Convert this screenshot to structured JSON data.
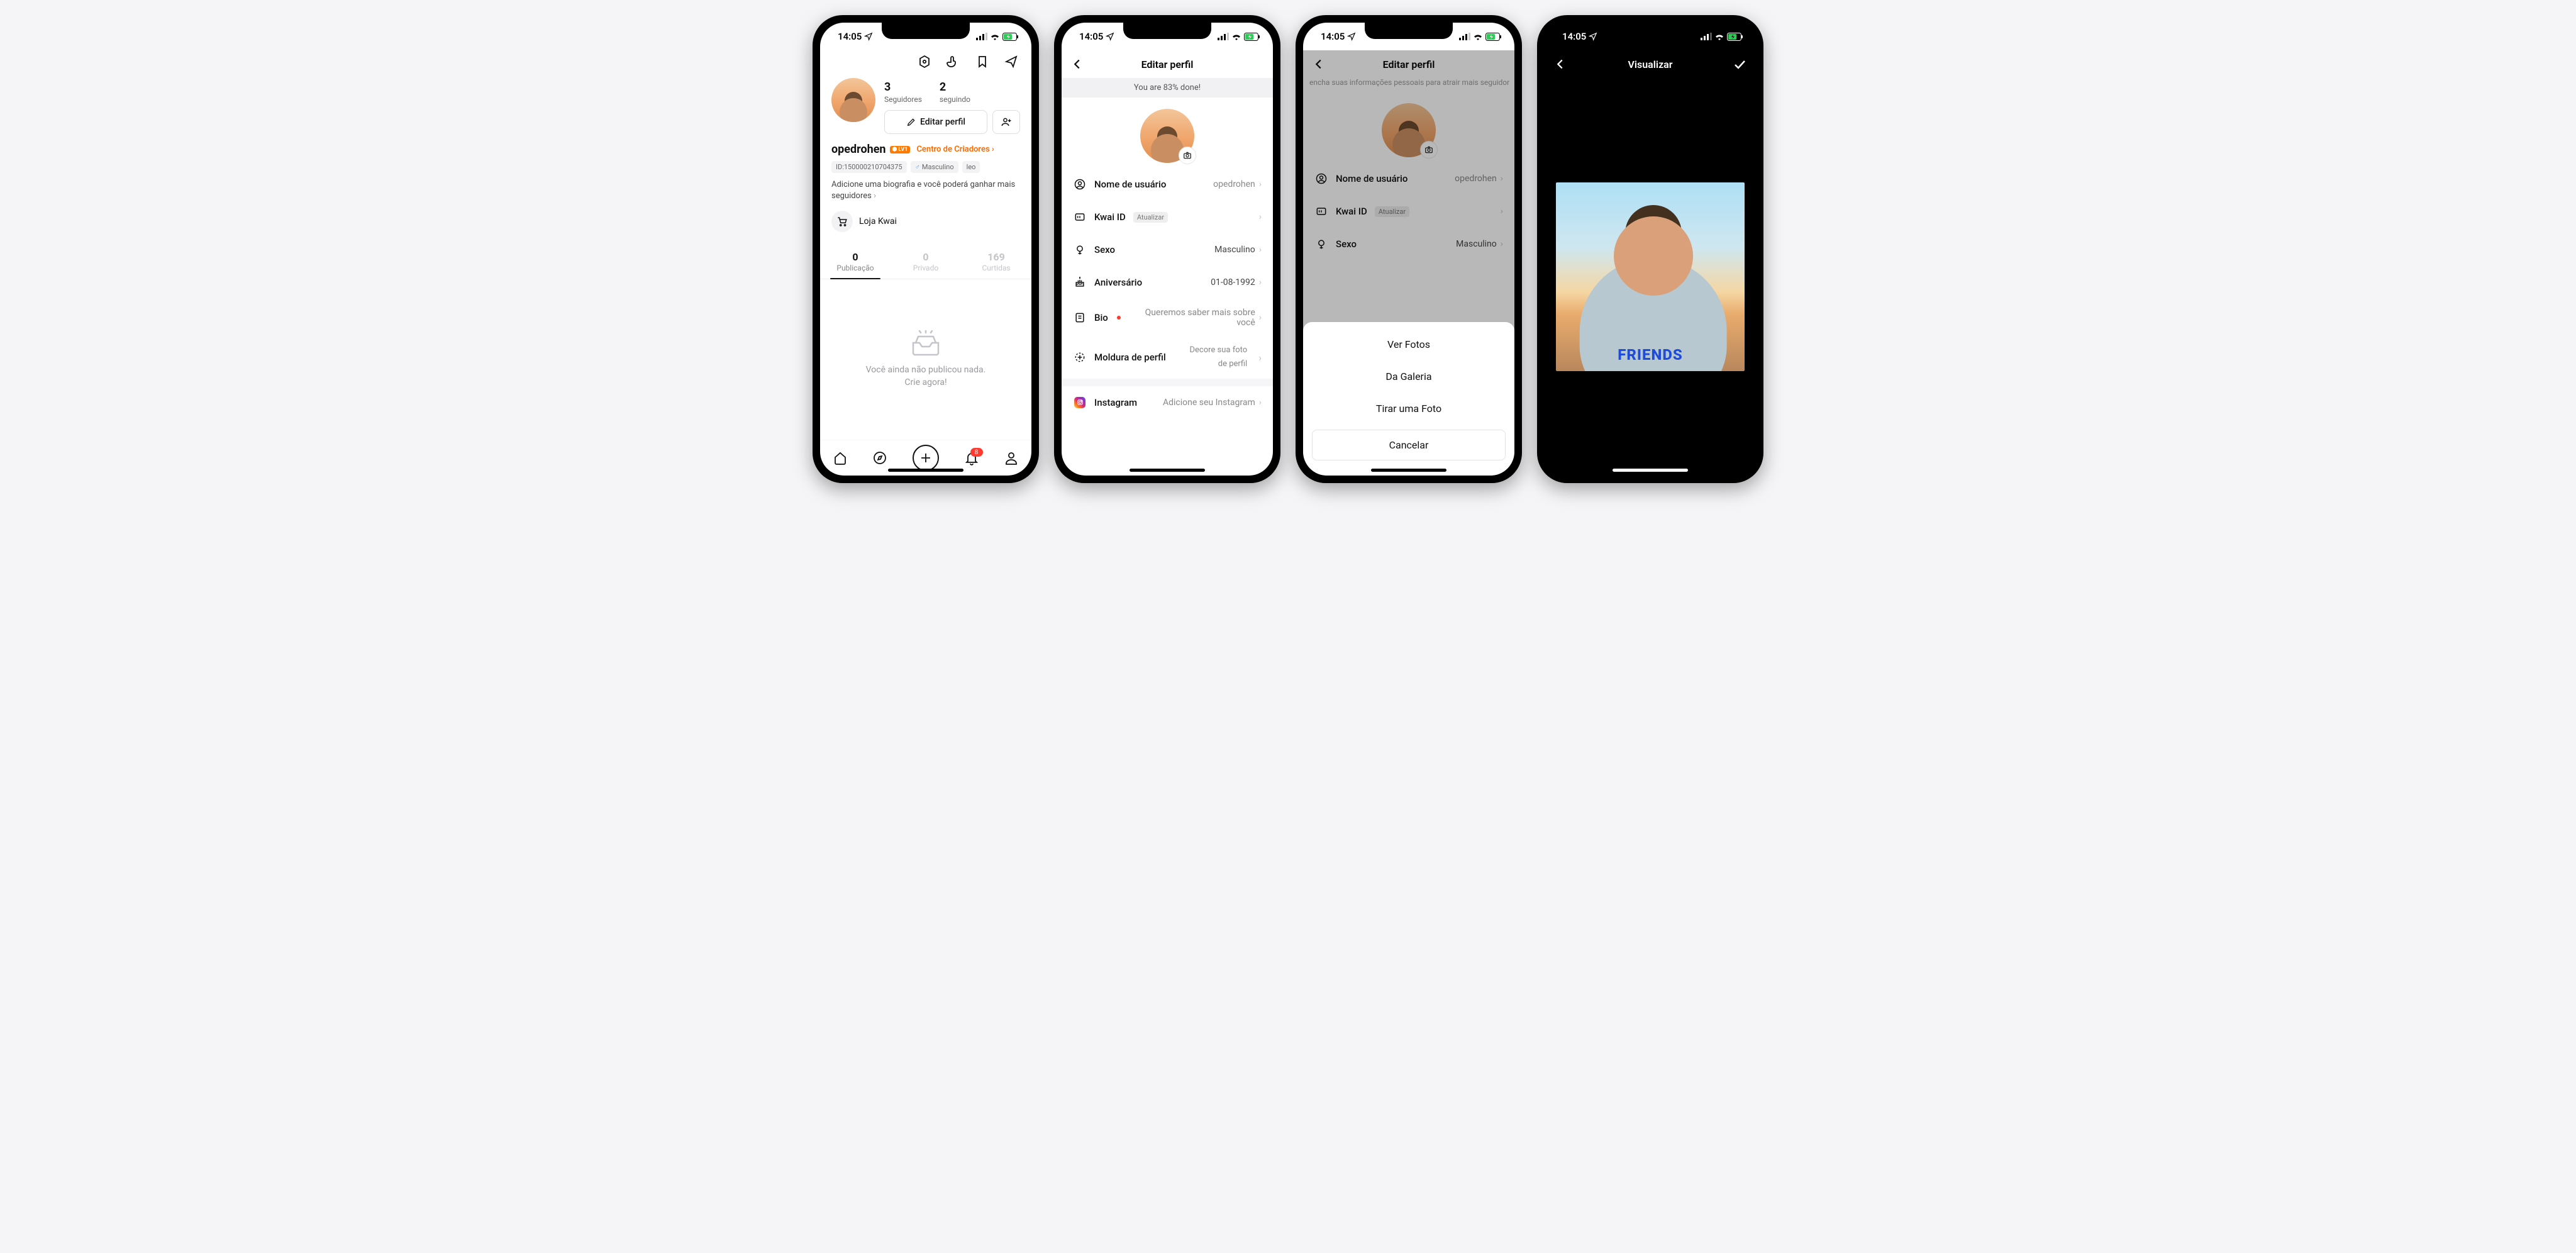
{
  "status": {
    "time": "14:05"
  },
  "screenA": {
    "stats": {
      "followers_count": "3",
      "followers_label": "Seguidores",
      "following_count": "2",
      "following_label": "seguindo"
    },
    "edit_button": "Editar perfil",
    "username": "opedrohen",
    "level_badge": "LV1",
    "creators_link": "Centro de Criadores",
    "id_label": "ID:150000210704375",
    "gender_tag": "Masculino",
    "zodiac_tag": "leo",
    "bio_hint": "Adicione uma biografia e você poderá ganhar mais seguidores",
    "store": "Loja Kwai",
    "tabs": {
      "pub_n": "0",
      "pub_l": "Publicação",
      "priv_n": "0",
      "priv_l": "Privado",
      "likes_n": "169",
      "likes_l": "Curtidas"
    },
    "empty_line1": "Você ainda não publicou nada.",
    "empty_line2": "Crie agora!",
    "notif_badge": "8"
  },
  "screenB": {
    "title": "Editar perfil",
    "banner": "You are 83% done!",
    "rows": {
      "username_label": "Nome de usuário",
      "username_value": "opedrohen",
      "kwai_label": "Kwai ID",
      "kwai_pill": "Atualizar",
      "gender_label": "Sexo",
      "gender_value": "Masculino",
      "birthday_label": "Aniversário",
      "birthday_value": "01-08-1992",
      "bio_label": "Bio",
      "bio_placeholder": "Queremos saber mais sobre você",
      "frame_label": "Moldura de perfil",
      "frame_value_1": "Decore sua foto",
      "frame_value_2": "de perfil",
      "instagram_label": "Instagram",
      "instagram_placeholder": "Adicione seu Instagram"
    }
  },
  "screenC": {
    "title": "Editar perfil",
    "subtitle": "encha suas informações pessoais para atrair mais seguidor",
    "rows": {
      "username_label": "Nome de usuário",
      "username_value": "opedrohen",
      "kwai_label": "Kwai ID",
      "kwai_pill": "Atualizar",
      "gender_label": "Sexo",
      "gender_value": "Masculino"
    },
    "sheet": {
      "view": "Ver Fotos",
      "gallery": "Da Galeria",
      "take": "Tirar uma Foto",
      "cancel": "Cancelar"
    }
  },
  "screenD": {
    "title": "Visualizar",
    "shirt_text": "FRIENDS"
  }
}
